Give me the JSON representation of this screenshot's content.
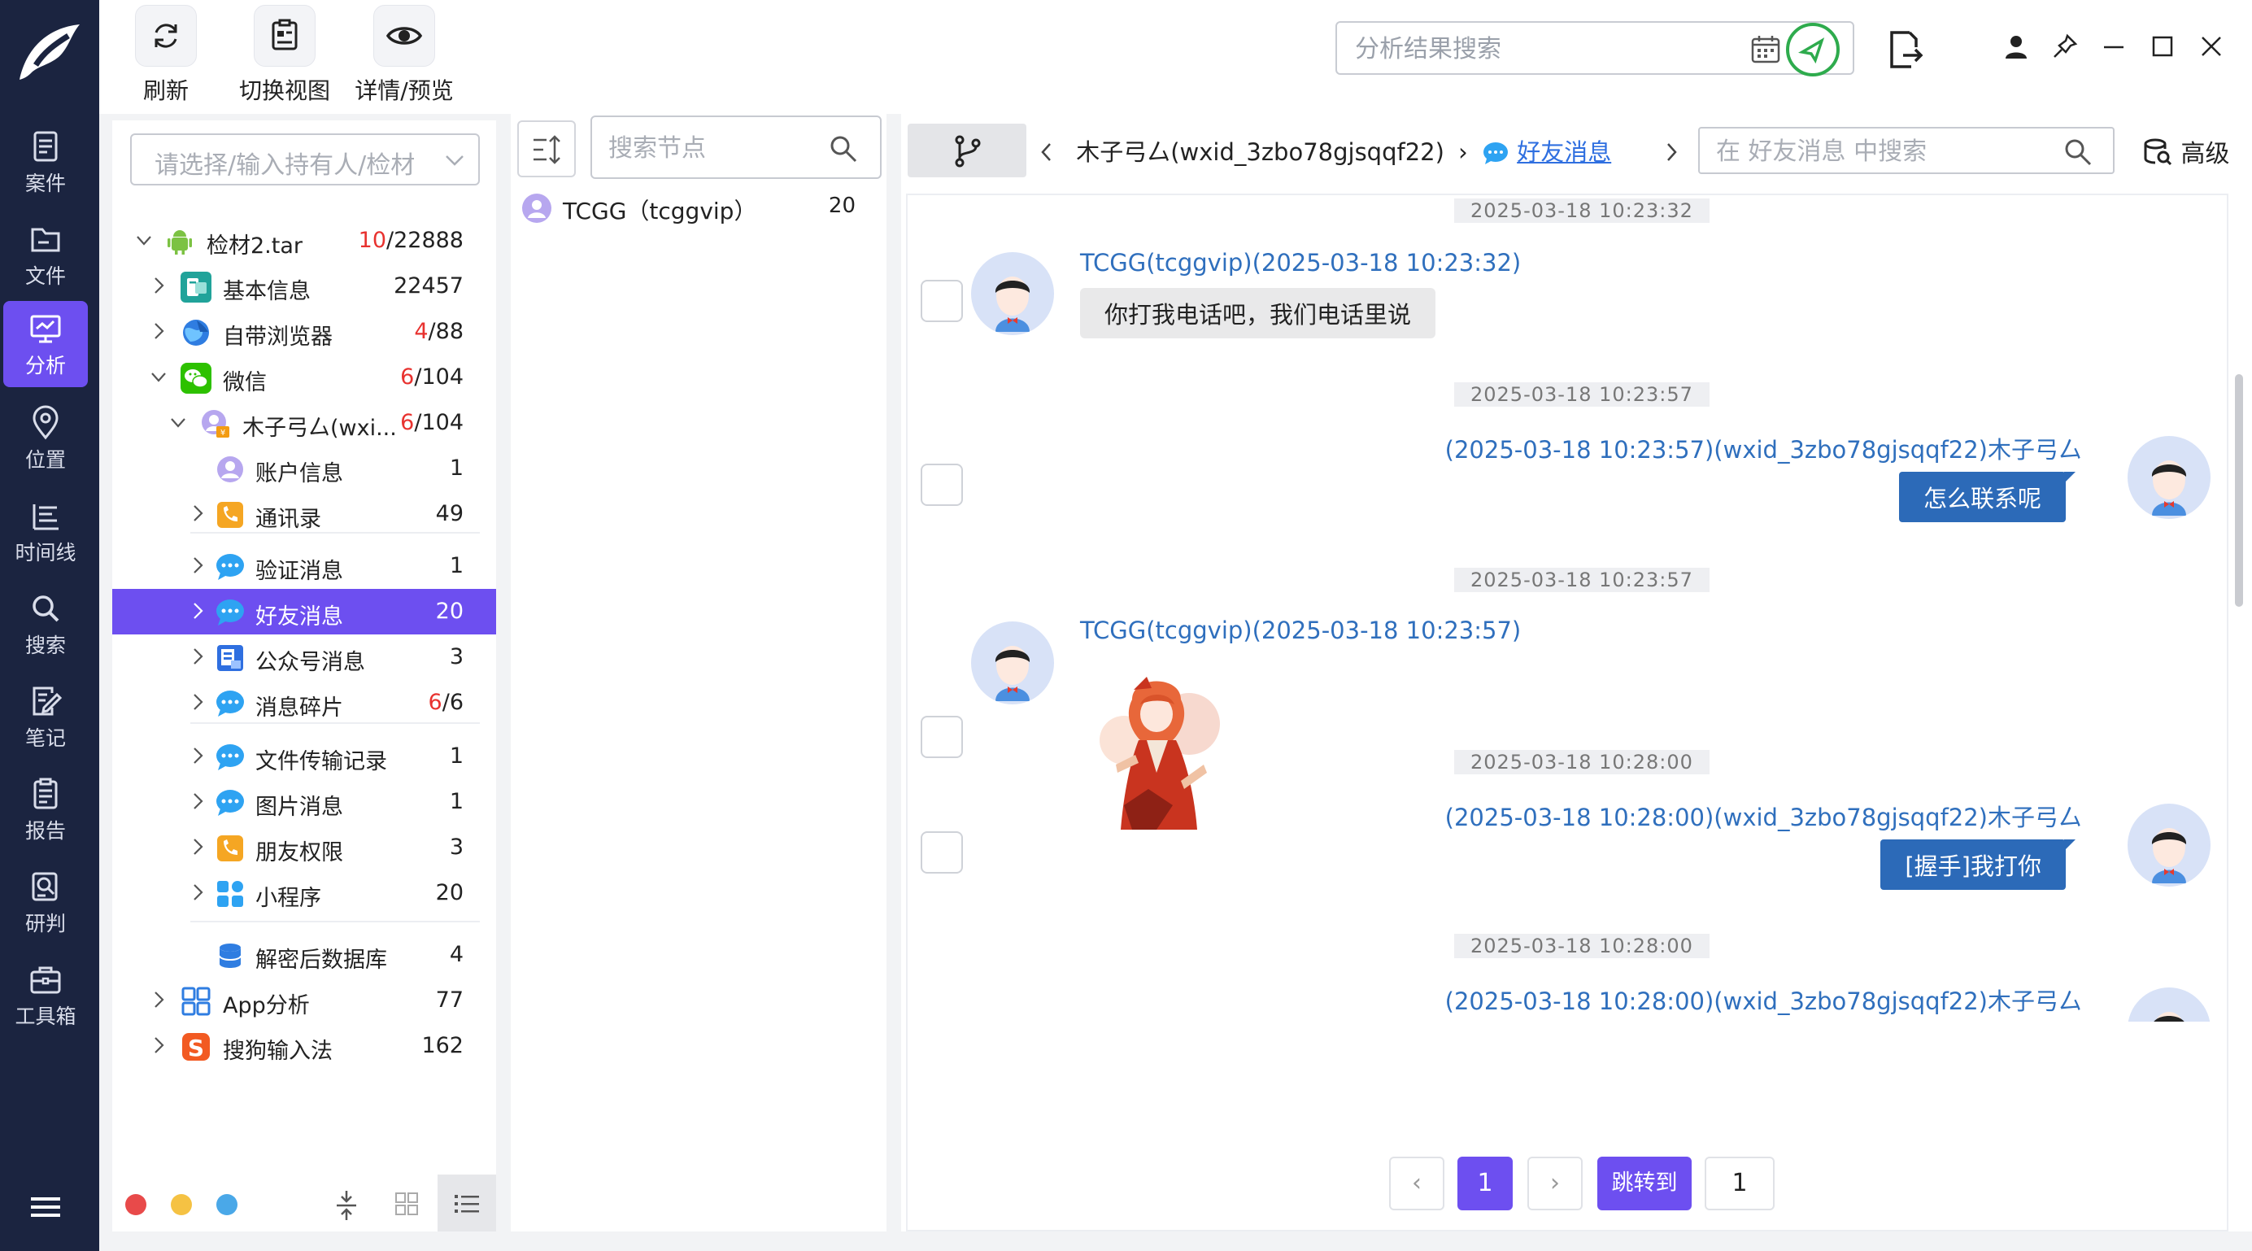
{
  "colors": {
    "accent": "#6d4ff0",
    "nav_bg": "#1b2440",
    "red": "#e8322f",
    "link": "#2f6fbd",
    "bubble_out": "#2c6ab8"
  },
  "nav": {
    "items": [
      {
        "label": "案件",
        "icon": "case-icon"
      },
      {
        "label": "文件",
        "icon": "folder-icon"
      },
      {
        "label": "分析",
        "icon": "analysis-icon"
      },
      {
        "label": "位置",
        "icon": "location-icon"
      },
      {
        "label": "时间线",
        "icon": "timeline-icon"
      },
      {
        "label": "搜索",
        "icon": "search-icon"
      },
      {
        "label": "笔记",
        "icon": "notes-icon"
      },
      {
        "label": "报告",
        "icon": "report-icon"
      },
      {
        "label": "研判",
        "icon": "judge-icon"
      },
      {
        "label": "工具箱",
        "icon": "toolbox-icon"
      }
    ]
  },
  "toolbar": {
    "refresh": "刷新",
    "switch_view": "切换视图",
    "details": "详情/预览",
    "search_placeholder": "分析结果搜索"
  },
  "tree": {
    "holder_placeholder": "请选择/输入持有人/检材",
    "rows": [
      {
        "label": "检材2.tar",
        "red": "10",
        "rest": "/22888"
      },
      {
        "label": "基本信息",
        "red": "",
        "rest": "22457"
      },
      {
        "label": "自带浏览器",
        "red": "4",
        "rest": "/88"
      },
      {
        "label": "微信",
        "red": "6",
        "rest": "/104"
      },
      {
        "label": "木子弓厶(wxi...",
        "red": "6",
        "rest": "/104"
      },
      {
        "label": "账户信息",
        "red": "",
        "rest": "1"
      },
      {
        "label": "通讯录",
        "red": "",
        "rest": "49"
      },
      {
        "label": "验证消息",
        "red": "",
        "rest": "1"
      },
      {
        "label": "好友消息",
        "red": "",
        "rest": "20"
      },
      {
        "label": "公众号消息",
        "red": "",
        "rest": "3"
      },
      {
        "label": "消息碎片",
        "red": "6",
        "rest": "/6"
      },
      {
        "label": "文件传输记录",
        "red": "",
        "rest": "1"
      },
      {
        "label": "图片消息",
        "red": "",
        "rest": "1"
      },
      {
        "label": "朋友权限",
        "red": "",
        "rest": "3"
      },
      {
        "label": "小程序",
        "red": "",
        "rest": "20"
      },
      {
        "label": "解密后数据库",
        "red": "",
        "rest": "4"
      },
      {
        "label": "App分析",
        "red": "",
        "rest": "77"
      },
      {
        "label": "搜狗输入法",
        "red": "",
        "rest": "162"
      }
    ]
  },
  "nodes": {
    "search_placeholder": "搜索节点",
    "items": [
      {
        "label": "TCGG（tcggvip）",
        "count": "20"
      }
    ]
  },
  "chat": {
    "crumb_contact": "木子弓厶(wxid_3zbo78gjsqqf22)",
    "crumb_sep": "›",
    "crumb_current": "好友消息",
    "search_placeholder": "在 好友消息 中搜索",
    "advanced": "高级",
    "messages": [
      {
        "time": "2025-03-18 10:23:32",
        "sender": "TCGG(tcggvip)(2025-03-18 10:23:32)",
        "text": "你打我电话吧，我们电话里说"
      },
      {
        "time": "2025-03-18 10:23:57",
        "sender": "(2025-03-18 10:23:57)(wxid_3zbo78gjsqqf22)木子弓厶",
        "text": "怎么联系呢"
      },
      {
        "time": "2025-03-18 10:23:57",
        "sender": "TCGG(tcggvip)(2025-03-18 10:23:57)",
        "text": ""
      },
      {
        "time": "2025-03-18 10:28:00",
        "sender": "(2025-03-18 10:28:00)(wxid_3zbo78gjsqqf22)木子弓厶",
        "text": "[握手]我打你"
      },
      {
        "time": "2025-03-18 10:28:00",
        "sender": "(2025-03-18 10:28:00)(wxid_3zbo78gjsqqf22)木子弓厶",
        "text": ""
      }
    ],
    "pager": {
      "prev": "‹",
      "page": "1",
      "next": "›",
      "jump": "跳转到",
      "jump_value": "1"
    }
  }
}
